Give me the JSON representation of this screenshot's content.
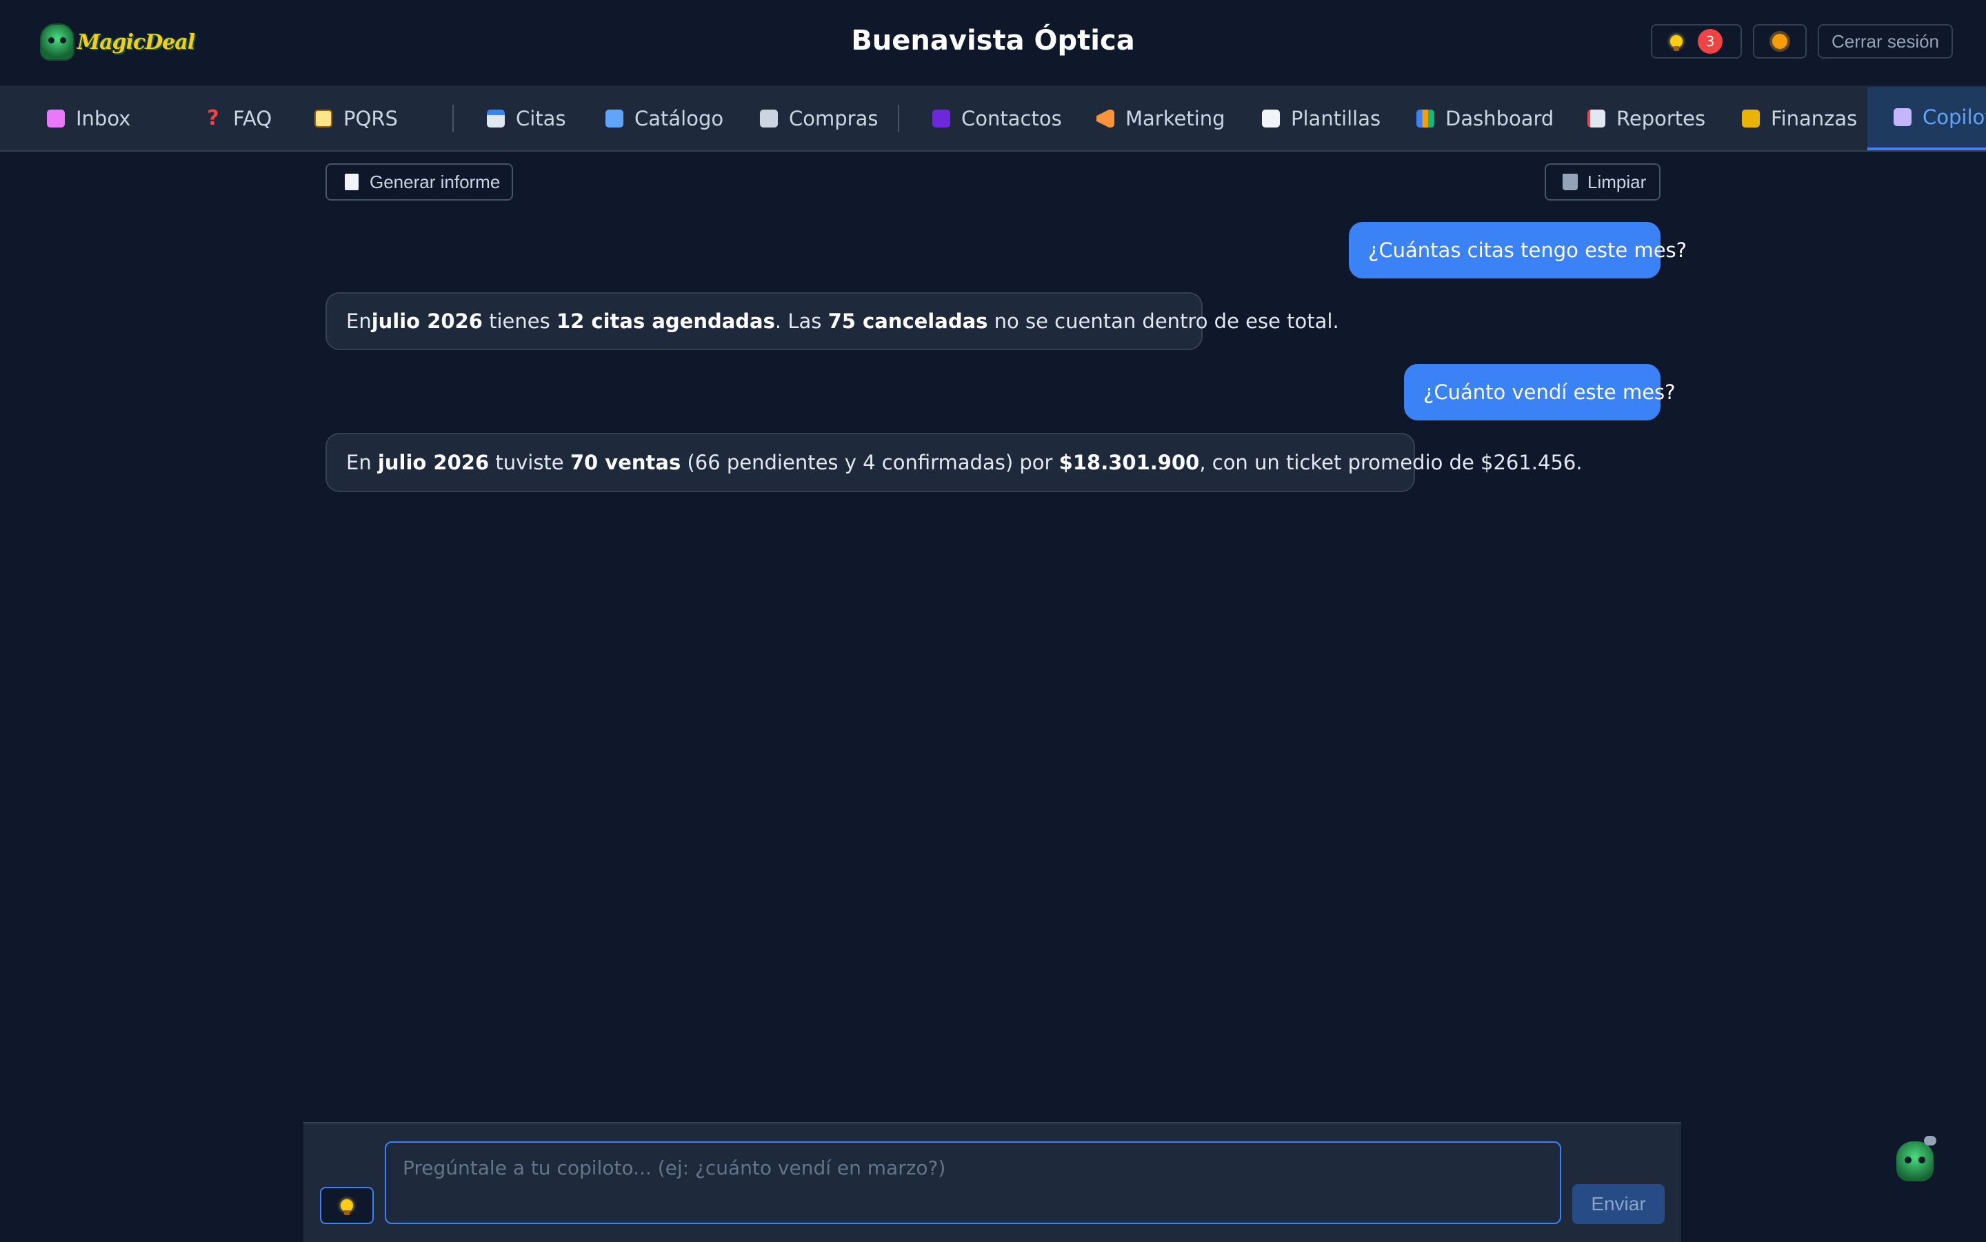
{
  "header": {
    "logo_text": "MagicDeal",
    "title": "Buenavista Óptica",
    "ideas_icon": "lightbulb-icon",
    "ideas_count": "3",
    "theme_icon": "sun-icon",
    "logout_label": "Cerrar sesión"
  },
  "nav": {
    "items": [
      {
        "label": "Inbox",
        "icon": "inbox-tray-icon"
      },
      {
        "label": "FAQ",
        "icon": "question-mark-icon"
      },
      {
        "label": "PQRS",
        "icon": "clipboard-icon"
      },
      {
        "label": "Citas",
        "icon": "calendar-icon"
      },
      {
        "label": "Catálogo",
        "icon": "shopping-bags-icon"
      },
      {
        "label": "Compras",
        "icon": "receipt-icon"
      },
      {
        "label": "Contactos",
        "icon": "person-icon"
      },
      {
        "label": "Marketing",
        "icon": "megaphone-icon"
      },
      {
        "label": "Plantillas",
        "icon": "document-icon"
      },
      {
        "label": "Dashboard",
        "icon": "bar-chart-icon"
      },
      {
        "label": "Reportes",
        "icon": "line-chart-icon"
      },
      {
        "label": "Finanzas",
        "icon": "money-bag-icon"
      },
      {
        "label": "Copilot",
        "icon": "robot-icon"
      }
    ],
    "active": "Copilot"
  },
  "toolbar": {
    "generate_label": "Generar informe",
    "clear_label": "Limpiar"
  },
  "messages": [
    {
      "role": "user",
      "text": "¿Cuántas citas tengo este mes?"
    },
    {
      "role": "bot",
      "parts": {
        "p1": "En ",
        "b1": "julio 2026",
        "p2": " tienes ",
        "b2": "12 citas agendadas",
        "p3": ". Las ",
        "b3": "75 canceladas",
        "p4": " no se cuentan dentro de ese total."
      }
    },
    {
      "role": "user",
      "text": "¿Cuánto vendí este mes?"
    },
    {
      "role": "bot",
      "parts": {
        "p1": "En ",
        "b1": "julio 2026",
        "p2": " tuviste ",
        "b2": "70 ventas",
        "p3": " (66 pendientes y 4 confirmadas) por ",
        "b3": "$18.301.900",
        "p4": ", con un ticket promedio de $261.456."
      }
    }
  ],
  "composer": {
    "placeholder": "Pregúntale a tu copiloto... (ej: ¿cuánto vendí en marzo?)",
    "value": "",
    "send_label": "Enviar"
  },
  "colors": {
    "background": "#0f172a",
    "surface": "#1e293b",
    "accent": "#3b82f6",
    "badge": "#ef4444"
  }
}
